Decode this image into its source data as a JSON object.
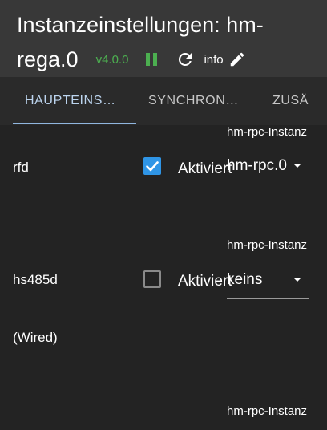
{
  "header": {
    "title_line1": "Instanzeinstellungen: hm-",
    "title_line2": "rega.0",
    "version": "v4.0.0",
    "info_label": "info",
    "version_color": "#4caf50",
    "pause_icon": "pause-icon",
    "reload_icon": "reload-icon",
    "edit_icon": "pencil-icon"
  },
  "tabs": [
    {
      "label": "HAUPTEINS…",
      "active": true
    },
    {
      "label": "SYNCHRON…",
      "active": false
    },
    {
      "label": "ZUSÄ",
      "active": false
    }
  ],
  "settings": {
    "rows": [
      {
        "label": "rfd",
        "enabled": true,
        "checkbox_label": "Aktiviert",
        "instance_caption": "hm-rpc-Instanz",
        "instance_value": "hm-rpc.0"
      },
      {
        "label": "hs485d",
        "enabled": false,
        "checkbox_label": "Aktiviert",
        "instance_caption": "hm-rpc-Instanz",
        "instance_value": "keins"
      },
      {
        "label": "(Wired)",
        "instance_caption": "hm-rpc-Instanz"
      }
    ]
  },
  "colors": {
    "accent": "#2f95e6",
    "tab_indicator": "#90b6df",
    "header_bg": "#383838",
    "page_bg": "#232323"
  }
}
